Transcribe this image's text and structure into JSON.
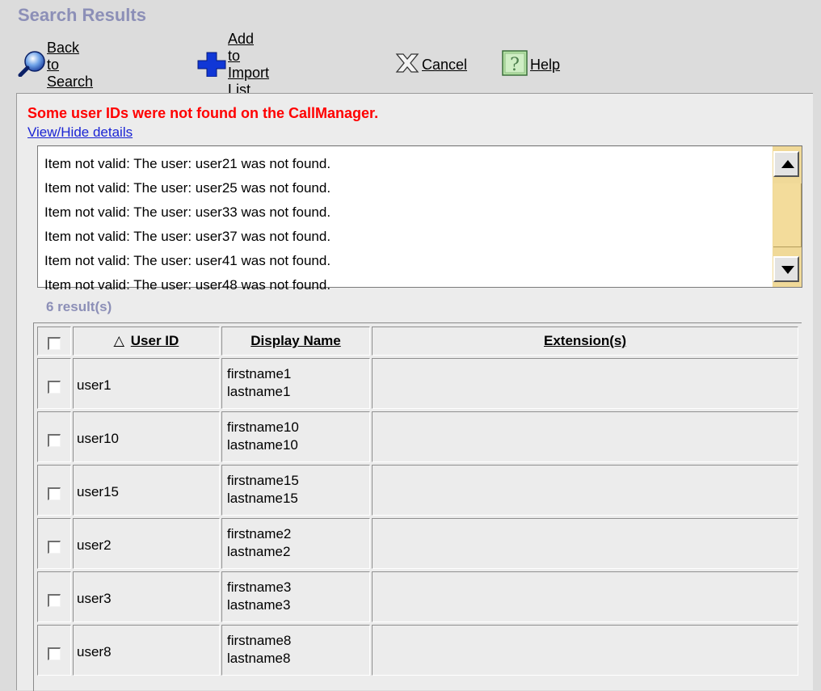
{
  "page_title": "Search Results",
  "toolbar": {
    "back_label": "Back to Search",
    "add_label": "Add to Import List",
    "cancel_label": "Cancel",
    "help_label": "Help"
  },
  "error_message": "Some user IDs were not found on the CallManager.",
  "details_link": "View/Hide details",
  "details_lines": [
    "Item not valid: The user: user21 was not found.",
    "Item not valid: The user: user25 was not found.",
    "Item not valid: The user: user33 was not found.",
    "Item not valid: The user: user37 was not found.",
    "Item not valid: The user: user41 was not found.",
    "Item not valid: The user: user48 was not found."
  ],
  "result_count": "6 result(s)",
  "table": {
    "sort_indicator": "△",
    "columns": {
      "user_id": "User ID",
      "display_name": "Display Name",
      "extensions": "Extension(s)"
    },
    "rows": [
      {
        "user_id": "user1",
        "first": "firstname1",
        "last": "lastname1",
        "extensions": ""
      },
      {
        "user_id": "user10",
        "first": "firstname10",
        "last": "lastname10",
        "extensions": ""
      },
      {
        "user_id": "user15",
        "first": "firstname15",
        "last": "lastname15",
        "extensions": ""
      },
      {
        "user_id": "user2",
        "first": "firstname2",
        "last": "lastname2",
        "extensions": ""
      },
      {
        "user_id": "user3",
        "first": "firstname3",
        "last": "lastname3",
        "extensions": ""
      },
      {
        "user_id": "user8",
        "first": "firstname8",
        "last": "lastname8",
        "extensions": ""
      }
    ]
  },
  "colors": {
    "title": "#8c8fb7",
    "error": "#ff0000",
    "link": "#1a24d4",
    "scrollbar": "#f0d998"
  },
  "icons": [
    "search-icon",
    "plus-icon",
    "cancel-icon",
    "help-icon"
  ]
}
